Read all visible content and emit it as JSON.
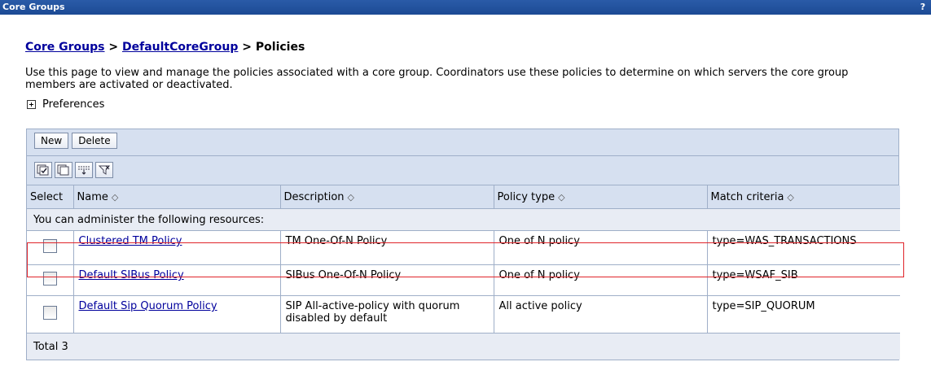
{
  "window": {
    "title": "Core Groups",
    "help_label": "?"
  },
  "breadcrumb": {
    "root": "Core Groups",
    "sep1": " > ",
    "group": "DefaultCoreGroup",
    "sep2": " > ",
    "current": "Policies"
  },
  "description": "Use this page to view and manage the policies associated with a core group. Coordinators use these policies to determine on which servers the core group members are activated or deactivated.",
  "preferences_label": "Preferences",
  "buttons": {
    "new": "New",
    "delete": "Delete"
  },
  "toolbar_icons": [
    "select-all-icon",
    "deselect-all-icon",
    "show-filter-icon",
    "clear-filter-icon"
  ],
  "table": {
    "headers": {
      "select": "Select",
      "name": "Name",
      "description": "Description",
      "policy_type": "Policy type",
      "match_criteria": "Match criteria"
    },
    "sort_glyph": "◇",
    "section_label": "You can administer the following resources:",
    "rows": [
      {
        "name": "Clustered TM Policy",
        "description": "TM One-Of-N Policy",
        "policy_type": "One of N policy",
        "match_criteria": "type=WAS_TRANSACTIONS",
        "checked": false
      },
      {
        "name": "Default SIBus Policy",
        "description": "SIBus One-Of-N Policy",
        "policy_type": "One of N policy",
        "match_criteria": "type=WSAF_SIB",
        "checked": false
      },
      {
        "name": "Default Sip Quorum Policy",
        "description": "SIP All-active-policy with quorum disabled by default",
        "policy_type": "All active policy",
        "match_criteria": "type=SIP_QUORUM",
        "checked": false
      }
    ],
    "total_label": "Total 3"
  },
  "colors": {
    "titlebar": "#1c4a94",
    "link": "#00009c",
    "header_bg": "#d6e0f0",
    "highlight": "#e0242a"
  }
}
